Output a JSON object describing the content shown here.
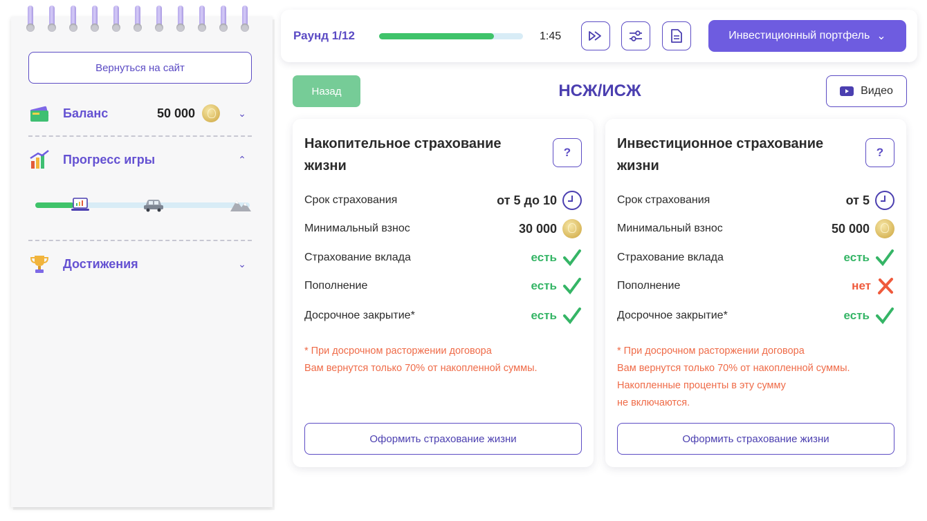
{
  "sidebar": {
    "back_to_site": "Вернуться на сайт",
    "balance": {
      "label": "Баланс",
      "value": "50 000",
      "icon": "wallet-icon"
    },
    "progress": {
      "label": "Прогресс игры",
      "fill_fraction": 0.18,
      "milestones": [
        "laptop-icon",
        "car-icon",
        "mountains-icon"
      ]
    },
    "achievements": {
      "label": "Достижения",
      "icon": "trophy-icon"
    }
  },
  "topbar": {
    "round": "Раунд 1/12",
    "round_progress_fraction": 0.8,
    "timer": "1:45",
    "portfolio_label": "Инвестиционный портфель"
  },
  "header": {
    "back_label": "Назад",
    "title": "НСЖ/ИСЖ",
    "video_label": "Видео"
  },
  "cards": [
    {
      "title": "Накопительное страхование жизни",
      "help": "?",
      "rows": [
        {
          "label": "Срок страхования",
          "value": "от 5 до 10"
        },
        {
          "label": "Минимальный взнос",
          "value": "30 000"
        },
        {
          "label": "Страхование вклада",
          "value": "есть"
        },
        {
          "label": "Пополнение",
          "value": "есть"
        },
        {
          "label": "Досрочное закрытие*",
          "value": "есть"
        }
      ],
      "note_lines": [
        "* При досрочном расторжении договора",
        "Вам вернутся только 70% от накопленной суммы."
      ],
      "cta": "Оформить страхование жизни"
    },
    {
      "title": "Инвестиционное страхование жизни",
      "help": "?",
      "rows": [
        {
          "label": "Срок страхования",
          "value": "от 5"
        },
        {
          "label": "Минимальный взнос",
          "value": "50 000"
        },
        {
          "label": "Страхование вклада",
          "value": "есть"
        },
        {
          "label": "Пополнение",
          "value": "нет"
        },
        {
          "label": "Досрочное закрытие*",
          "value": "есть"
        }
      ],
      "note_lines": [
        "* При досрочном расторжении договора",
        "Вам вернутся только 70% от накопленной суммы.",
        "Накопленные проценты в эту сумму",
        "не включаются."
      ],
      "cta": "Оформить страхование жизни"
    }
  ],
  "colors": {
    "accent": "#6e5ce0",
    "green": "#35b566",
    "red": "#ef5a3c",
    "title": "#4b3fb0"
  }
}
